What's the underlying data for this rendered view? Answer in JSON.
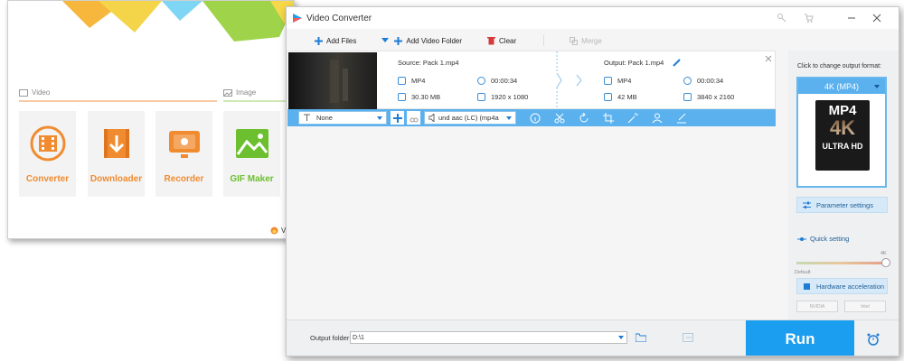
{
  "main_menu": {
    "sections": {
      "video_label": "Video",
      "image_label": "Image"
    },
    "tiles": [
      {
        "label": "Converter",
        "color": "#f08b30"
      },
      {
        "label": "Downloader",
        "color": "#f08b30"
      },
      {
        "label": "Recorder",
        "color": "#f08b30"
      },
      {
        "label": "GIF Maker",
        "color": "#6cbf2e"
      }
    ],
    "partial_text": "V"
  },
  "converter": {
    "title": "Video Converter",
    "toolbar": {
      "add_files": "Add Files",
      "add_video_folder": "Add Video Folder",
      "clear": "Clear",
      "merge": "Merge"
    },
    "file": {
      "source_label": "Source: Pack 1.mp4",
      "output_label": "Output: Pack 1.mp4",
      "source": {
        "format": "MP4",
        "duration": "00:00:34",
        "size": "30.30 MB",
        "resolution": "1920 x 1080"
      },
      "output": {
        "format": "MP4",
        "duration": "00:00:34",
        "size": "42 MB",
        "resolution": "3840 x 2160"
      }
    },
    "edit_bar": {
      "subtitle": "None",
      "audio": "und aac (LC) (mp4a"
    },
    "right_panel": {
      "caption": "Click to change output format:",
      "format": "4K (MP4)",
      "badge_top": "MP4",
      "badge_mid": "4K",
      "badge_bottom": "ULTRA HD",
      "parameter_settings": "Parameter settings",
      "quick_setting": "Quick setting",
      "slider_max": "4K",
      "slider_min": "Default",
      "hardware_acceleration": "Hardware acceleration",
      "nvidia": "NVIDIA",
      "intel": "Intel"
    },
    "bottom": {
      "output_folder_label": "Output folder:",
      "output_folder_value": "D:\\1",
      "run": "Run"
    },
    "accent_color": "#1b9ef0"
  }
}
